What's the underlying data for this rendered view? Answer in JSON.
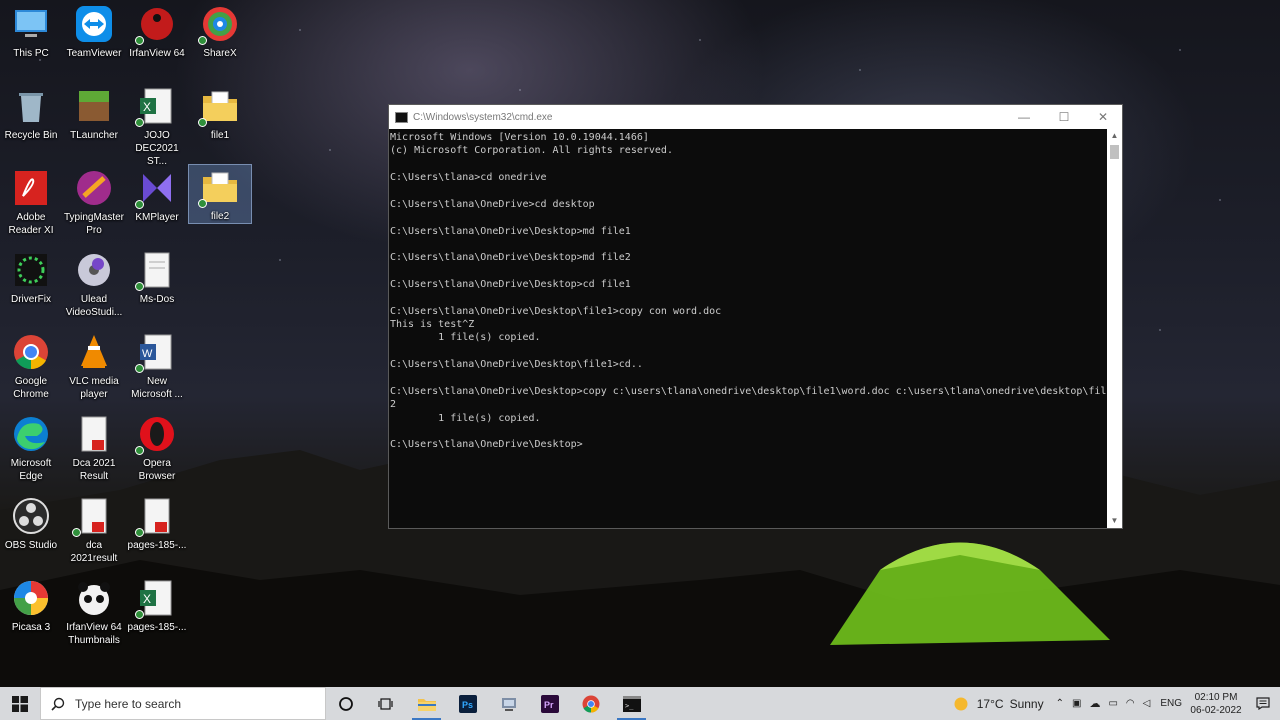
{
  "desktop": {
    "icons": [
      {
        "label": "This PC"
      },
      {
        "label": "TeamViewer"
      },
      {
        "label": "IrfanView 64"
      },
      {
        "label": "ShareX"
      },
      {
        "label": "Recycle Bin"
      },
      {
        "label": "TLauncher"
      },
      {
        "label": "JOJO DEC2021 ST..."
      },
      {
        "label": "file1"
      },
      {
        "label": "Adobe Reader XI"
      },
      {
        "label": "TypingMaster Pro"
      },
      {
        "label": "KMPlayer"
      },
      {
        "label": "file2"
      },
      {
        "label": "DriverFix"
      },
      {
        "label": "Ulead VideoStudi..."
      },
      {
        "label": "Ms-Dos"
      },
      {
        "label": "Google Chrome"
      },
      {
        "label": "VLC media player"
      },
      {
        "label": "New Microsoft ..."
      },
      {
        "label": "Microsoft Edge"
      },
      {
        "label": "Dca 2021 Result"
      },
      {
        "label": "Opera Browser"
      },
      {
        "label": "OBS Studio"
      },
      {
        "label": "dca 2021result"
      },
      {
        "label": "pages-185-..."
      },
      {
        "label": "Picasa 3"
      },
      {
        "label": "IrfanView 64 Thumbnails"
      },
      {
        "label": "pages-185-..."
      }
    ]
  },
  "cmd": {
    "title": "C:\\Windows\\system32\\cmd.exe",
    "output": "Microsoft Windows [Version 10.0.19044.1466]\n(c) Microsoft Corporation. All rights reserved.\n\nC:\\Users\\tlana>cd onedrive\n\nC:\\Users\\tlana\\OneDrive>cd desktop\n\nC:\\Users\\tlana\\OneDrive\\Desktop>md file1\n\nC:\\Users\\tlana\\OneDrive\\Desktop>md file2\n\nC:\\Users\\tlana\\OneDrive\\Desktop>cd file1\n\nC:\\Users\\tlana\\OneDrive\\Desktop\\file1>copy con word.doc\nThis is test^Z\n        1 file(s) copied.\n\nC:\\Users\\tlana\\OneDrive\\Desktop\\file1>cd..\n\nC:\\Users\\tlana\\OneDrive\\Desktop>copy c:\\users\\tlana\\onedrive\\desktop\\file1\\word.doc c:\\users\\tlana\\onedrive\\desktop\\file\n2\n        1 file(s) copied.\n\nC:\\Users\\tlana\\OneDrive\\Desktop>",
    "minimize": "—",
    "maximize": "☐",
    "close": "✕"
  },
  "taskbar": {
    "search_placeholder": "Type here to search",
    "weather_temp": "17°C",
    "weather_desc": "Sunny",
    "language": "ENG",
    "time": "02:10 PM",
    "date": "06-02-2022",
    "apps": [
      "File Explorer",
      "Photoshop",
      "Network Tool",
      "Premiere",
      "Chrome",
      "Command Prompt"
    ]
  },
  "colors": {
    "taskbar": "#d7d9dc",
    "console_bg": "#0c0c0c",
    "console_text": "#cccccc",
    "accent": "#3b78c4"
  }
}
